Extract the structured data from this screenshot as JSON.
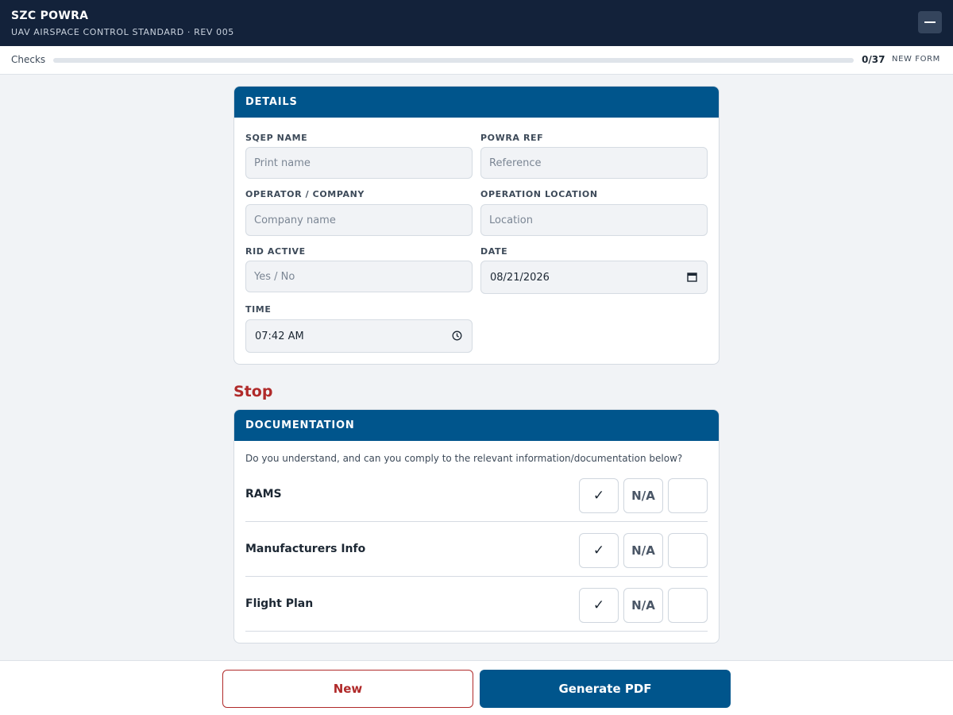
{
  "header": {
    "title": "SZC POWRA",
    "subtitle": "UAV AIRSPACE CONTROL STANDARD · REV 005",
    "collapse_icon": "minus-icon"
  },
  "progress": {
    "label": "Checks",
    "count": "0/37",
    "completed": 0,
    "total": 37,
    "status": "NEW FORM"
  },
  "details": {
    "header": "DETAILS",
    "sqep_name": {
      "label": "SQEP NAME",
      "placeholder": "Print name"
    },
    "powra_ref": {
      "label": "POWRA REF",
      "placeholder": "Reference"
    },
    "operator": {
      "label": "OPERATOR / COMPANY",
      "placeholder": "Company name"
    },
    "location": {
      "label": "OPERATION LOCATION",
      "placeholder": "Location"
    },
    "rid_active": {
      "label": "RID ACTIVE",
      "placeholder": "Yes / No"
    },
    "date": {
      "label": "DATE",
      "value": "08/21/2026",
      "icon": "calendar-icon"
    },
    "time": {
      "label": "TIME",
      "value": "07:42 AM",
      "icon": "clock-icon"
    }
  },
  "stop_section": {
    "title": "Stop"
  },
  "documentation": {
    "header": "DOCUMENTATION",
    "intro": "Do you understand, and can you comply to the relevant information/documentation below?",
    "options": {
      "check": "✓",
      "na": "N/A",
      "blank": ""
    },
    "items": [
      {
        "label": "RAMS"
      },
      {
        "label": "Manufacturers Info"
      },
      {
        "label": "Flight Plan"
      }
    ]
  },
  "footer": {
    "new_label": "New",
    "pdf_label": "Generate PDF"
  },
  "colors": {
    "topbar": "#13223a",
    "accent": "#00558c",
    "danger": "#b02a2a"
  }
}
